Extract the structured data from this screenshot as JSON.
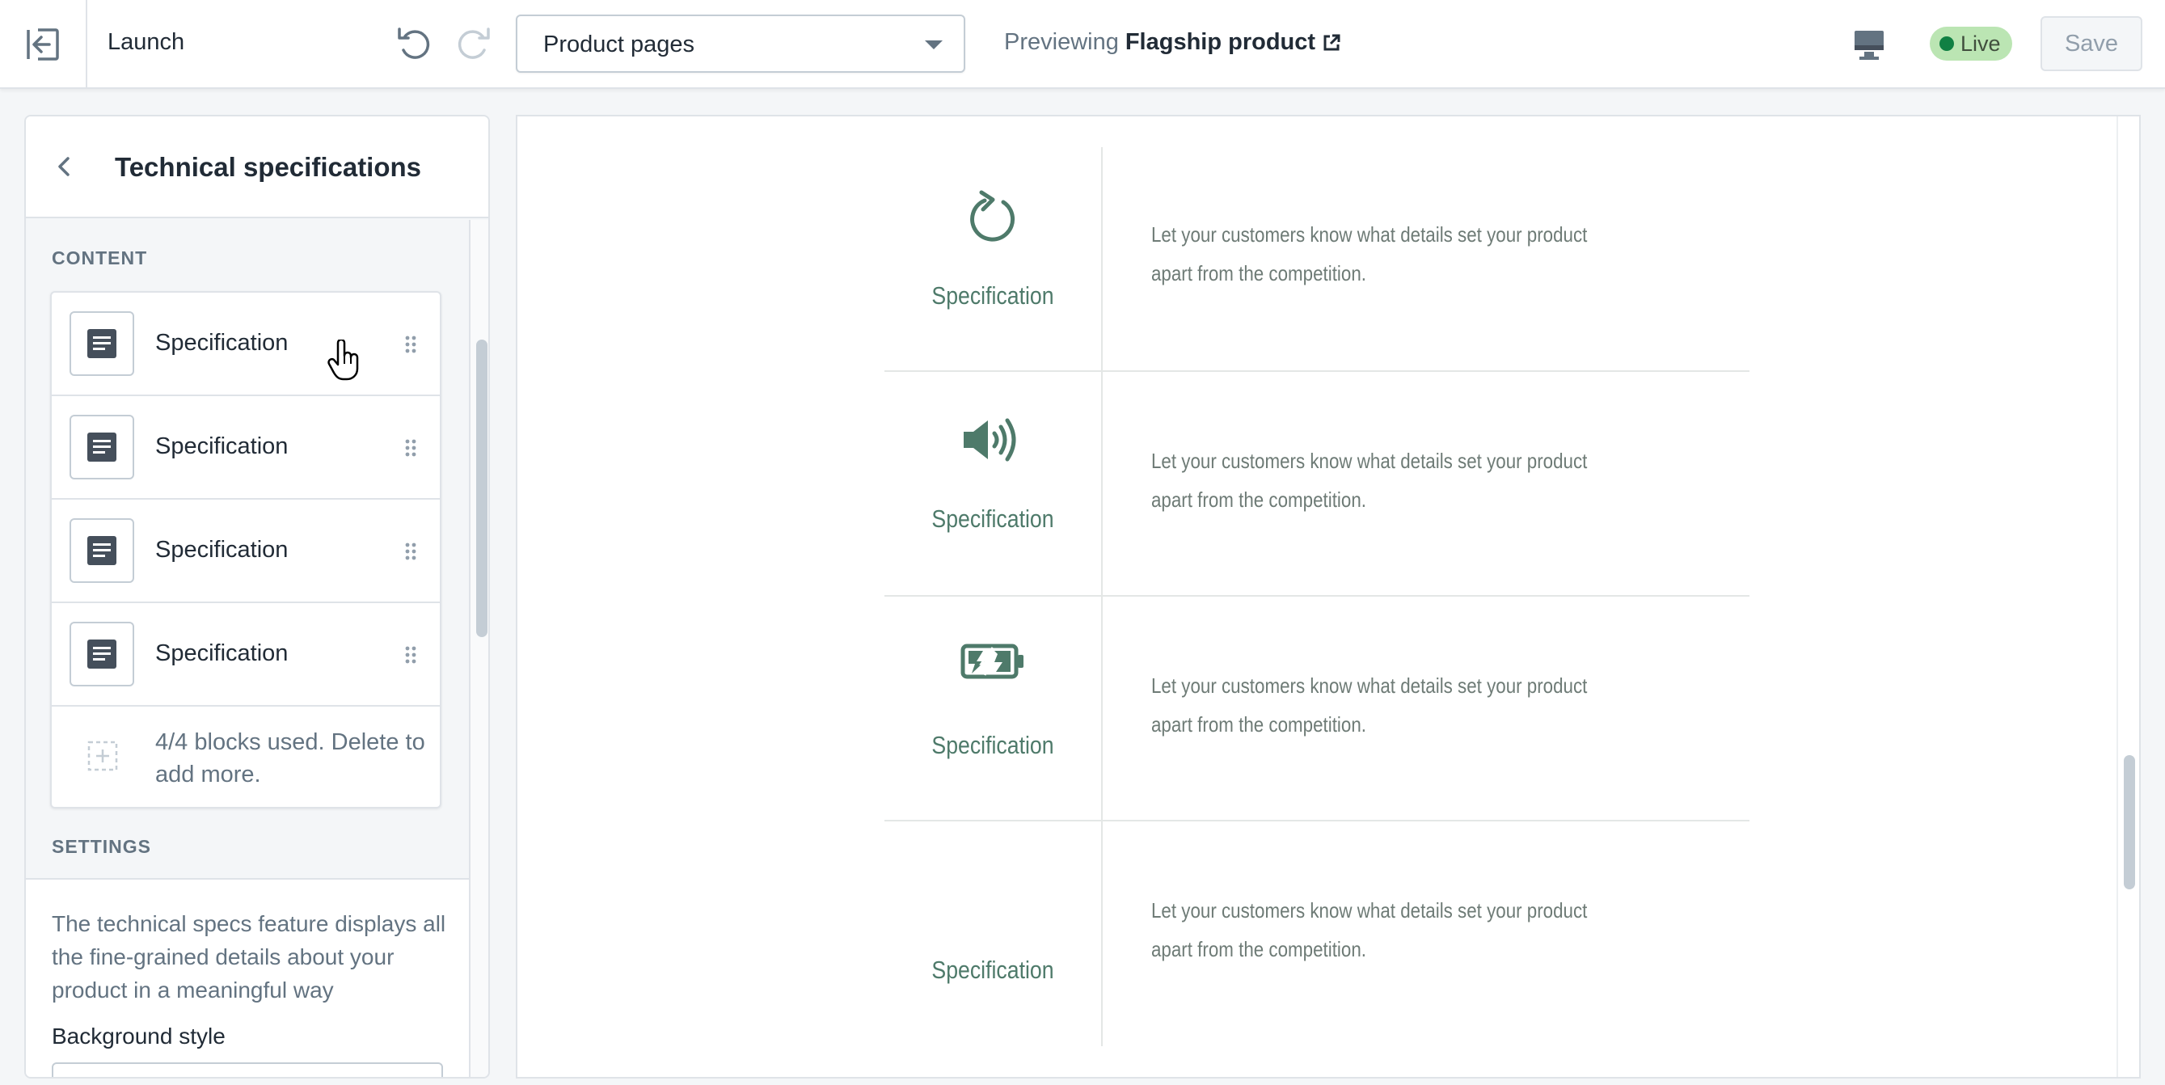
{
  "topbar": {
    "theme_name": "Launch",
    "page_select_value": "Product pages",
    "previewing_prefix": "Previewing",
    "previewing_product": "Flagship product",
    "status_badge": "Live",
    "save_label": "Save"
  },
  "sidebar": {
    "title": "Technical specifications",
    "content_label": "CONTENT",
    "blocks": [
      {
        "label": "Specification"
      },
      {
        "label": "Specification"
      },
      {
        "label": "Specification"
      },
      {
        "label": "Specification"
      }
    ],
    "blocks_limit_text": "4/4 blocks used. Delete to add more.",
    "settings_label": "SETTINGS",
    "settings_description": "The technical specs feature displays all the fine-grained details about your product in a meaningful way",
    "background_style_label": "Background style"
  },
  "preview": {
    "specs": [
      {
        "icon": "refresh-icon",
        "name": "Specification",
        "description": "Let your customers know what details set your product apart from the competition."
      },
      {
        "icon": "speaker-icon",
        "name": "Specification",
        "description": "Let your customers know what details set your product apart from the competition."
      },
      {
        "icon": "battery-charging-icon",
        "name": "Specification",
        "description": "Let your customers know what details set your product apart from the competition."
      },
      {
        "icon": "",
        "name": "Specification",
        "description": "Let your customers know what details set your product apart from the competition."
      }
    ]
  },
  "colors": {
    "accent_green": "#4e7a6a",
    "live_badge_bg": "#bbe5b3",
    "live_dot": "#108043"
  }
}
